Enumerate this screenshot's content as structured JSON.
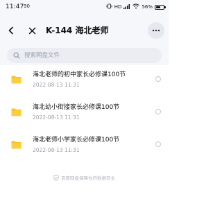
{
  "status_bar": {
    "time": "11:47",
    "left_extra": "90",
    "signal_text": "HD",
    "battery_text": "56%",
    "battery_level": 0.56
  },
  "header": {
    "title": "K-144 海北老师"
  },
  "search": {
    "placeholder": "搜索网盘文件"
  },
  "files": [
    {
      "name": "海北老师的初中家长必修课100节",
      "date": "2022-08-13  11:31"
    },
    {
      "name": "海北幼小衔接家长必修课100节",
      "date": "2022-08-13  11:31"
    },
    {
      "name": "海北老师小学家长必修课100节",
      "date": "2022-08-13  11:31"
    }
  ],
  "footer": {
    "text": "百度网盘保障你的数据安全"
  },
  "colors": {
    "background": "#f6f7fb",
    "folder": "#f7c22e",
    "text_primary": "#111111",
    "text_secondary": "#9aa0ab"
  },
  "icons": {
    "back": "chevron-left-icon",
    "close": "close-icon",
    "more": "more-horizontal-icon",
    "search": "search-icon",
    "folder": "folder-icon",
    "shield": "shield-icon"
  }
}
